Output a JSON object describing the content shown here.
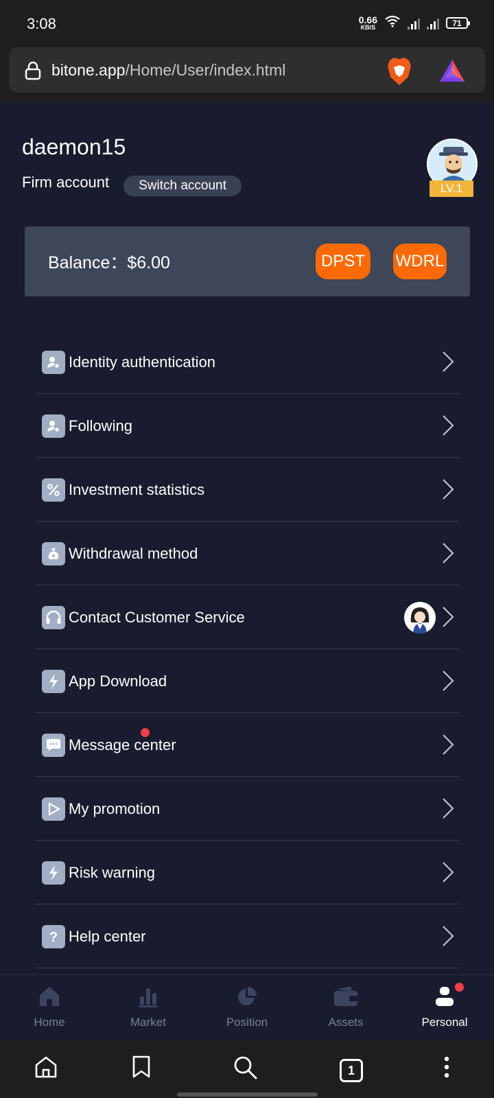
{
  "status_bar": {
    "time": "3:08",
    "net_speed_value": "0.66",
    "net_speed_unit": "KB/S",
    "battery": "71"
  },
  "browser": {
    "url_host": "bitone.app",
    "url_path": "/Home/User/index.html",
    "tab_count": "1"
  },
  "profile": {
    "username": "daemon15",
    "account_type": "Firm account",
    "switch_label": "Switch account",
    "level_badge": "LV.1"
  },
  "balance": {
    "text": "Balance：$6.00",
    "deposit_label": "DPST",
    "withdraw_label": "WDRL"
  },
  "menu": {
    "items": [
      {
        "label": "Identity authentication",
        "icon": "user-badge-icon"
      },
      {
        "label": "Following",
        "icon": "user-follow-icon"
      },
      {
        "label": "Investment statistics",
        "icon": "percent-icon"
      },
      {
        "label": "Withdrawal method",
        "icon": "money-bag-icon"
      },
      {
        "label": "Contact Customer Service",
        "icon": "headset-icon"
      },
      {
        "label": "App Download",
        "icon": "lightning-icon"
      },
      {
        "label": "Message center",
        "icon": "chat-icon"
      },
      {
        "label": "My promotion",
        "icon": "play-icon"
      },
      {
        "label": "Risk warning",
        "icon": "lightning-icon"
      },
      {
        "label": "Help center",
        "icon": "question-icon"
      }
    ]
  },
  "app_nav": {
    "items": [
      {
        "label": "Home",
        "icon": "home-icon"
      },
      {
        "label": "Market",
        "icon": "bar-chart-icon"
      },
      {
        "label": "Position",
        "icon": "pie-chart-icon"
      },
      {
        "label": "Assets",
        "icon": "wallet-icon"
      },
      {
        "label": "Personal",
        "icon": "person-icon",
        "active": true
      }
    ]
  },
  "colors": {
    "background": "#191c2e",
    "card": "#3e4659",
    "accent_orange": "#ff6a00",
    "badge_yellow": "#f5b43a",
    "notification_red": "#ef3f48"
  }
}
